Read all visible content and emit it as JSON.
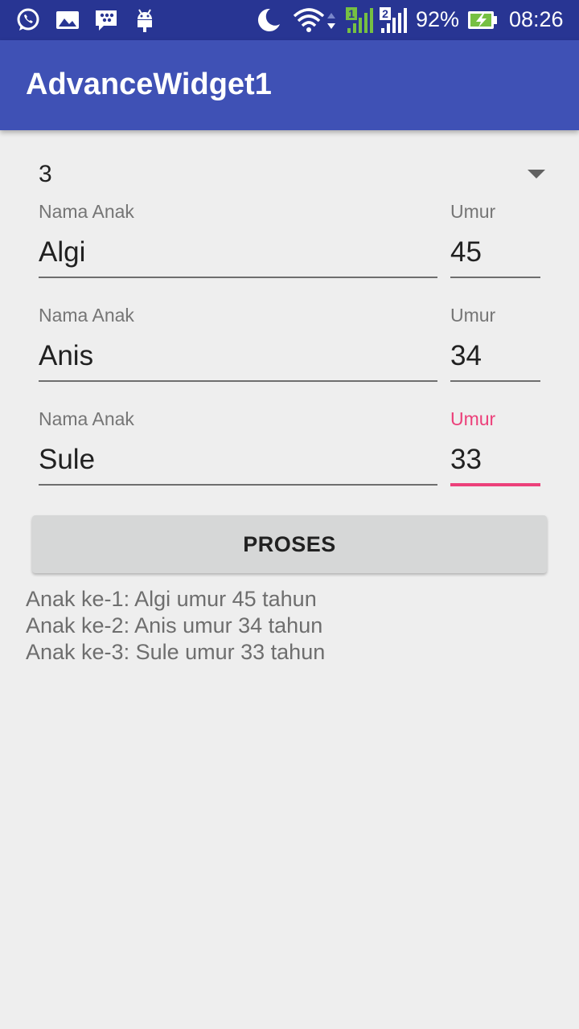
{
  "status_bar": {
    "battery": "92%",
    "time": "08:26",
    "sim1_label": "1",
    "sim2_label": "2",
    "left_icons": [
      "whatsapp-icon",
      "gallery-icon",
      "bbm-icon",
      "android-icon"
    ],
    "right_icons": [
      "moon-icon",
      "wifi-icon",
      "signal-sim1-icon",
      "signal-sim2-icon",
      "battery-charging-icon"
    ]
  },
  "app_bar": {
    "title": "AdvanceWidget1"
  },
  "spinner": {
    "selected": "3"
  },
  "children": [
    {
      "name_label": "Nama Anak",
      "name_value": "Algi",
      "age_label": "Umur",
      "age_value": "45"
    },
    {
      "name_label": "Nama Anak",
      "name_value": "Anis",
      "age_label": "Umur",
      "age_value": "34"
    },
    {
      "name_label": "Nama Anak",
      "name_value": "Sule",
      "age_label": "Umur",
      "age_value": "33",
      "age_focused": true
    }
  ],
  "button": {
    "label": "PROSES"
  },
  "result": [
    "Anak ke-1: Algi umur 45 tahun",
    "Anak ke-2: Anis umur 34 tahun",
    "Anak ke-3: Sule umur 33 tahun"
  ],
  "colors": {
    "status_bar": "#283593",
    "primary": "#3f51b5",
    "accent": "#ec407a",
    "background": "#eeeeee",
    "battery_green": "#76c043"
  }
}
